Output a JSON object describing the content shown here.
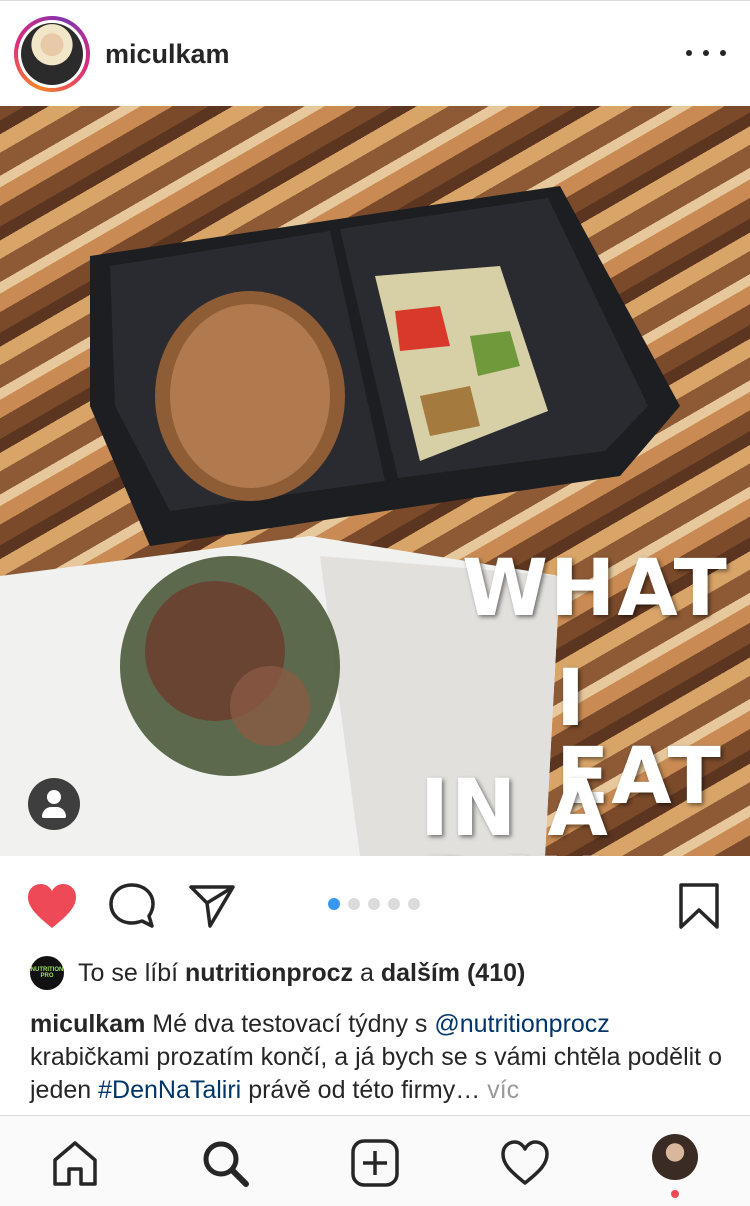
{
  "header": {
    "username": "miculkam",
    "avatar_icon": "profile-avatar",
    "more_icon": "more-horizontal-icon"
  },
  "post": {
    "overlay_lines": [
      "WHAT",
      "I EAT",
      "IN A DAY"
    ],
    "user_tag_icon": "person-tag-icon",
    "carousel": {
      "count": 5,
      "active_index": 0
    }
  },
  "actions": {
    "like_icon": "heart-filled-icon",
    "comment_icon": "comment-icon",
    "share_icon": "paper-plane-icon",
    "save_icon": "bookmark-icon"
  },
  "likes": {
    "logo_text": "NUTRITION PRO",
    "prefix": "To se líbí ",
    "user": "nutritionprocz",
    "connector": " a ",
    "others": "dalším (410)"
  },
  "caption": {
    "username": "miculkam",
    "text1": " Mé dva testovací týdny s ",
    "mention": "@nutritionprocz",
    "text2": " krabičkami prozatím končí, a já bych se s vámi chtěla podělit o jeden ",
    "hashtag": "#DenNaTaliri",
    "text3": " právě od této firmy… ",
    "more": "víc"
  },
  "tabbar": {
    "items": [
      "home-icon",
      "search-icon",
      "add-post-icon",
      "activity-heart-icon",
      "profile-avatar"
    ]
  },
  "colors": {
    "like_red": "#ed4956",
    "link_blue": "#003569",
    "dot_active": "#3897f0",
    "muted": "#999999"
  }
}
